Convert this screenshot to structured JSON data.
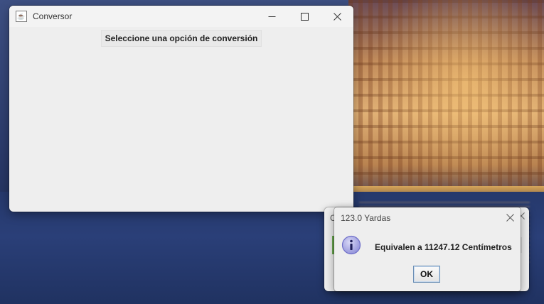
{
  "main_window": {
    "title": "Conversor",
    "app_icon": "java-icon",
    "controls": {
      "minimize_icon": "minimize-icon",
      "maximize_icon": "maximize-icon",
      "close_icon": "close-icon"
    },
    "option_button_label": "Seleccione una opción de conversión"
  },
  "back_dialog": {
    "title_fragment": "C",
    "close_icon": "close-icon"
  },
  "dialog": {
    "title": "123.0 Yardas",
    "icon": "information-icon",
    "message": "Equivalen a 11247.12 Centímetros",
    "ok_label": "OK",
    "close_icon": "close-icon"
  },
  "colors": {
    "window_bg": "#eeeeee",
    "info_icon": "#6f6fc9",
    "ok_border": "#6b8fb5"
  }
}
